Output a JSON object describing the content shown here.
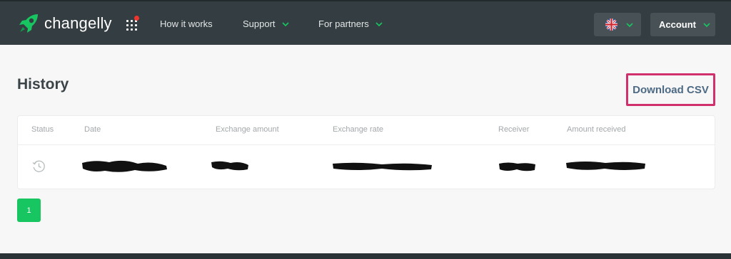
{
  "header": {
    "brand": "changelly",
    "nav": [
      {
        "label": "How it works"
      },
      {
        "label": "Support"
      },
      {
        "label": "For partners"
      }
    ],
    "account_label": "Account"
  },
  "main": {
    "title": "History",
    "download_label": "Download CSV",
    "columns": [
      "Status",
      "Date",
      "Exchange amount",
      "Exchange rate",
      "Receiver",
      "Amount received"
    ],
    "pager": {
      "current_page": "1"
    }
  },
  "colors": {
    "brand_green": "#17c660",
    "header_bg": "#343d41",
    "highlight": "#d0306b",
    "notification_dot": "#f0352f"
  },
  "icons": [
    "rocket-logo-icon",
    "apps-grid-icon",
    "chevron-down-icon",
    "uk-flag-icon",
    "clock-history-icon"
  ]
}
